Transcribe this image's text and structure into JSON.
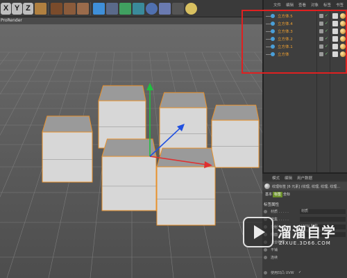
{
  "toolbar": {
    "axis_buttons": [
      "X",
      "Y",
      "Z"
    ],
    "tools": [
      "coordinate-system-icon",
      "render-view-icon",
      "render-picture-viewer-icon",
      "render-settings-icon",
      "cube-icon",
      "pen-icon",
      "subdivision-icon",
      "deformer-icon",
      "capsule-icon",
      "environment-icon",
      "camera-icon",
      "light-icon"
    ]
  },
  "viewport": {
    "menu_label": "ProRender"
  },
  "object_manager": {
    "tabs": [
      "文件",
      "编辑",
      "查看",
      "对象",
      "标签",
      "书签"
    ],
    "objects": [
      {
        "name": "立方体.5"
      },
      {
        "name": "立方体.4"
      },
      {
        "name": "立方体.3"
      },
      {
        "name": "立方体.2"
      },
      {
        "name": "立方体.1"
      },
      {
        "name": "立方体"
      }
    ],
    "name_color": "#f0a030"
  },
  "attribute_manager": {
    "menu": [
      "模式",
      "编辑",
      "用户数据"
    ],
    "header_label": "纹理标签 [6 元素] (纹理, 纹理, 纹理, 纹理...",
    "subtabs": [
      "基本",
      "标签",
      "坐标"
    ],
    "active_subtab": "标签",
    "section_title": "标签属性",
    "rows": [
      {
        "label": "材质 . . . . .",
        "value": "材质"
      },
      {
        "label": "选集 . . . . .",
        "value": ""
      },
      {
        "label": "投射 . . . . .",
        "value": "UVW 贴图"
      },
      {
        "label": "侧面 . . . . .",
        "value": ""
      },
      {
        "label": "混合纹理",
        "value": ""
      },
      {
        "label": "平铺",
        "value": ""
      },
      {
        "label": "连续",
        "value": ""
      },
      {
        "label": "使用凹凸 UVW",
        "value": "✓"
      }
    ]
  },
  "watermark": {
    "title": "溜溜自学",
    "subtitle": "ZIXUE.3D66.COM"
  },
  "colors": {
    "highlight_box": "#e02020",
    "selection_outline": "#e8902a",
    "axis_y": "#20c040",
    "axis_x": "#e03030",
    "axis_z": "#2050e0"
  }
}
